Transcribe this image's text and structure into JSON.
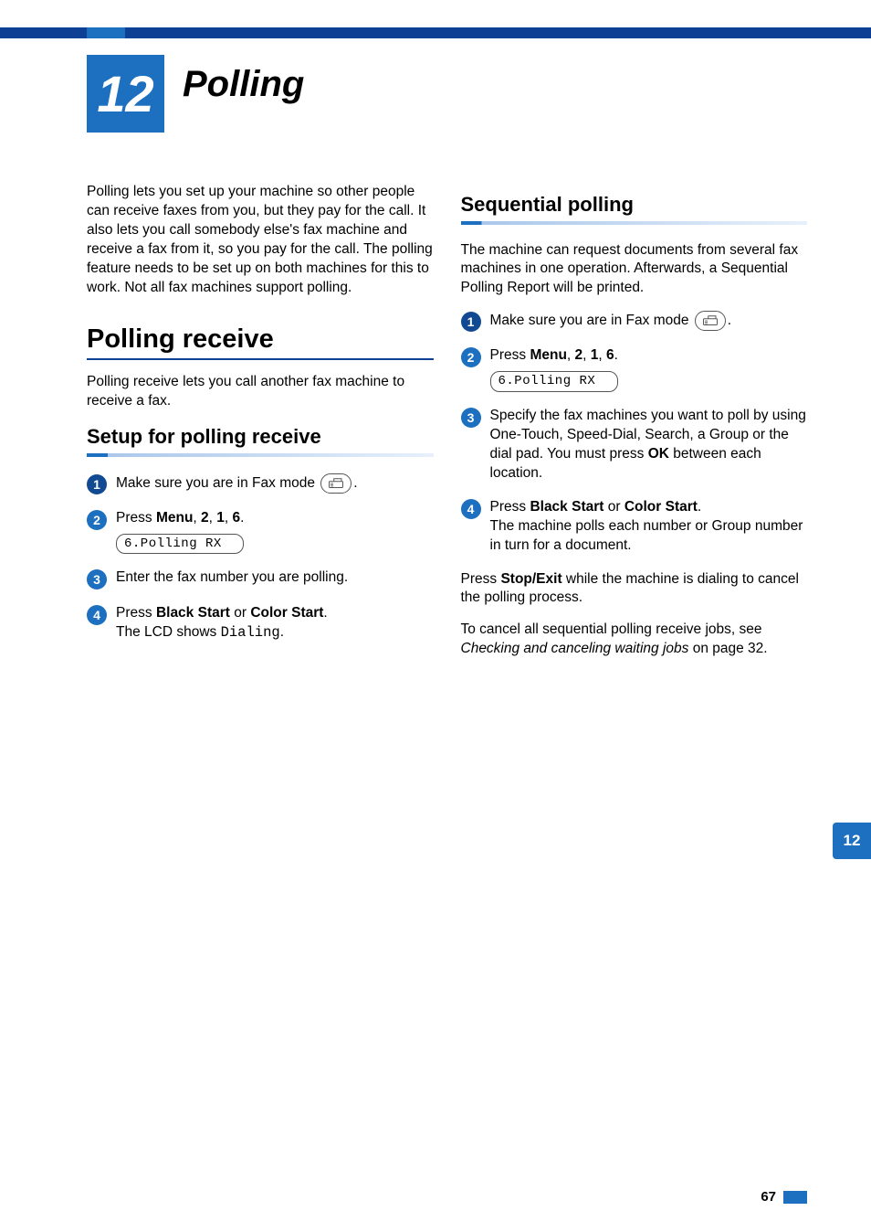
{
  "chapter": {
    "number": "12",
    "title": "Polling"
  },
  "intro": "Polling lets you set up your machine so other people can receive faxes from you, but they pay for the call. It also lets you call somebody else's fax machine and receive a fax from it, so you pay for the call. The polling feature needs to be set up on both machines for this to work. Not all fax machines support polling.",
  "left": {
    "title": "Polling receive",
    "desc": "Polling receive lets you call another fax machine to receive a fax.",
    "sub": "Setup for polling receive",
    "steps": {
      "s1_a": "Make sure you are in Fax mode ",
      "s1_b": ".",
      "s2_a": "Press ",
      "s2_menu": "Menu",
      "s2_b": ", ",
      "s2_n1": "2",
      "s2_c": ", ",
      "s2_n2": "1",
      "s2_d": ", ",
      "s2_n3": "6",
      "s2_e": ".",
      "lcd": "6.Polling RX",
      "s3": "Enter the fax number you are polling.",
      "s4_a": "Press ",
      "s4_b1": "Black Start",
      "s4_b": " or ",
      "s4_b2": "Color Start",
      "s4_c": ".",
      "s4_line2a": "The LCD shows ",
      "s4_line2b": "Dialing",
      "s4_line2c": "."
    }
  },
  "right": {
    "sub": "Sequential polling",
    "desc": "The machine can request documents from several fax machines in one operation. Afterwards, a Sequential Polling Report will be printed.",
    "steps": {
      "s1_a": "Make sure you are in Fax mode ",
      "s1_b": ".",
      "s2_a": "Press ",
      "s2_menu": "Menu",
      "s2_b": ", ",
      "s2_n1": "2",
      "s2_c": ", ",
      "s2_n2": "1",
      "s2_d": ", ",
      "s2_n3": "6",
      "s2_e": ".",
      "lcd": "6.Polling RX",
      "s3_a": "Specify the fax machines you want to poll by using One-Touch, Speed-Dial, Search, a Group or the dial pad. You must press ",
      "s3_ok": "OK",
      "s3_b": " between each location.",
      "s4_a": "Press ",
      "s4_b1": "Black Start",
      "s4_b": " or ",
      "s4_b2": "Color Start",
      "s4_c": ".",
      "s4_line2": "The machine polls each number or Group number in turn for a document."
    },
    "p1_a": "Press ",
    "p1_b": "Stop/Exit",
    "p1_c": " while the machine is dialing to cancel the polling process.",
    "p2_a": "To cancel all sequential polling receive jobs, see ",
    "p2_i": "Checking and canceling waiting jobs",
    "p2_b": " on page 32."
  },
  "sideTab": "12",
  "footer": {
    "page": "67"
  }
}
